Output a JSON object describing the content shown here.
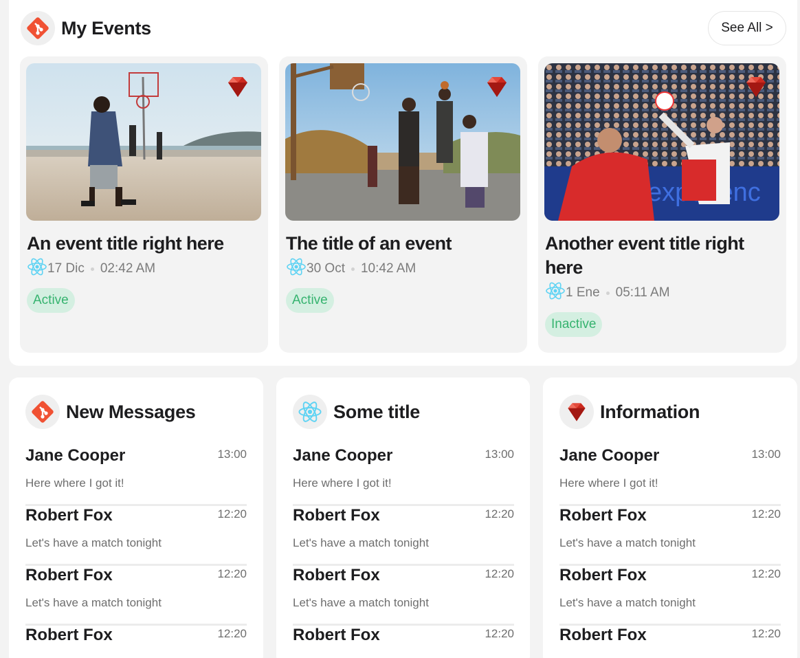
{
  "my_events": {
    "title": "My Events",
    "see_all_label": "See All >",
    "events": [
      {
        "title": "An event title right here",
        "date": "17 Dic",
        "time": "02:42 AM",
        "status": "Active"
      },
      {
        "title": "The title of an event",
        "date": "30 Oct",
        "time": "10:42 AM",
        "status": "Active"
      },
      {
        "title": "Another event title right here",
        "date": "1 Ene",
        "time": "05:11 AM",
        "status": "Inactive"
      }
    ]
  },
  "cards": [
    {
      "title": "New Messages",
      "icon": "git-icon",
      "messages": [
        {
          "name": "Jane Cooper",
          "time": "13:00",
          "text": "Here where I got it!"
        },
        {
          "name": "Robert Fox",
          "time": "12:20",
          "text": "Let's have a match tonight"
        },
        {
          "name": "Robert Fox",
          "time": "12:20",
          "text": "Let's have a match tonight"
        },
        {
          "name": "Robert Fox",
          "time": "12:20",
          "text": ""
        }
      ]
    },
    {
      "title": "Some title",
      "icon": "react-icon",
      "messages": [
        {
          "name": "Jane Cooper",
          "time": "13:00",
          "text": "Here where I got it!"
        },
        {
          "name": "Robert Fox",
          "time": "12:20",
          "text": "Let's have a match tonight"
        },
        {
          "name": "Robert Fox",
          "time": "12:20",
          "text": "Let's have a match tonight"
        },
        {
          "name": "Robert Fox",
          "time": "12:20",
          "text": ""
        }
      ]
    },
    {
      "title": "Information",
      "icon": "ruby-icon",
      "messages": [
        {
          "name": "Jane Cooper",
          "time": "13:00",
          "text": "Here where I got it!"
        },
        {
          "name": "Robert Fox",
          "time": "12:20",
          "text": "Let's have a match tonight"
        },
        {
          "name": "Robert Fox",
          "time": "12:20",
          "text": "Let's have a match tonight"
        },
        {
          "name": "Robert Fox",
          "time": "12:20",
          "text": ""
        }
      ]
    }
  ],
  "colors": {
    "status_text": "#36b36f",
    "status_bg": "#d4efe1",
    "git_orange": "#f05133",
    "react_blue": "#5fd3f3",
    "ruby_red": "#cc2a1f"
  }
}
